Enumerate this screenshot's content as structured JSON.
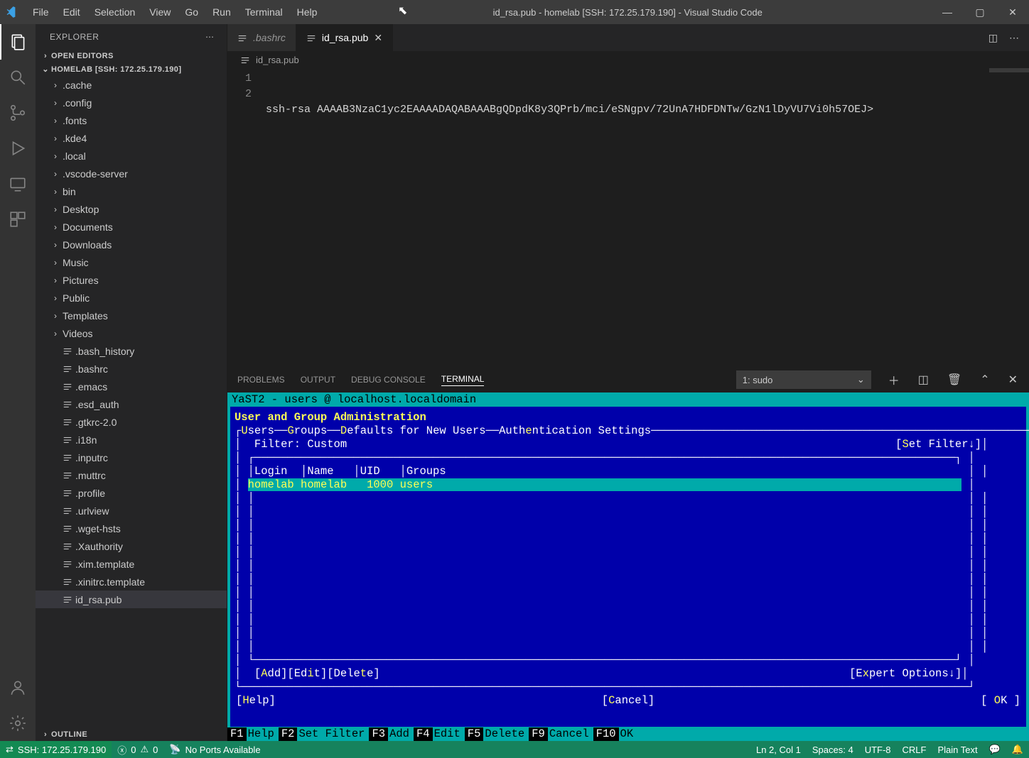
{
  "titlebar": {
    "menus": [
      "File",
      "Edit",
      "Selection",
      "View",
      "Go",
      "Run",
      "Terminal",
      "Help"
    ],
    "title": "id_rsa.pub - homelab [SSH: 172.25.179.190] - Visual Studio Code"
  },
  "sidebar": {
    "title": "EXPLORER",
    "open_editors_label": "OPEN EDITORS",
    "workspace_label": "HOMELAB [SSH: 172.25.179.190]",
    "outline_label": "OUTLINE",
    "folders": [
      ".cache",
      ".config",
      ".fonts",
      ".kde4",
      ".local",
      ".vscode-server",
      "bin",
      "Desktop",
      "Documents",
      "Downloads",
      "Music",
      "Pictures",
      "Public",
      "Templates",
      "Videos"
    ],
    "files": [
      ".bash_history",
      ".bashrc",
      ".emacs",
      ".esd_auth",
      ".gtkrc-2.0",
      ".i18n",
      ".inputrc",
      ".muttrc",
      ".profile",
      ".urlview",
      ".wget-hsts",
      ".Xauthority",
      ".xim.template",
      ".xinitrc.template",
      "id_rsa.pub"
    ],
    "selected_file": "id_rsa.pub"
  },
  "tabs": {
    "items": [
      {
        "name": ".bashrc",
        "active": false,
        "italic": true
      },
      {
        "name": "id_rsa.pub",
        "active": true,
        "italic": false
      }
    ]
  },
  "breadcrumb": {
    "file": "id_rsa.pub"
  },
  "editor": {
    "line1": "ssh-rsa AAAAB3NzaC1yc2EAAAADAQABAAABgQDpdK8y3QPrb/mci/eSNgpv/72UnA7HDFDNTw/GzN1lDyVU7Vi0h57OEJ>",
    "line_numbers": [
      "1",
      "2"
    ]
  },
  "panel": {
    "tabs": [
      "PROBLEMS",
      "OUTPUT",
      "DEBUG CONSOLE",
      "TERMINAL"
    ],
    "active_tab": "TERMINAL",
    "terminal_select": "1: sudo"
  },
  "yast": {
    "topbar": "YaST2 - users @ localhost.localdomain",
    "heading": "User and Group Administration",
    "tabs_raw": "┌Users──Groups──Defaults for New Users──Authentication Settings───────────────────────────────────────────────┐",
    "filter_label": "Filter: Custom",
    "set_filter": "[Set Filter↓]",
    "table_header": "│Login  │Name   │UID   │Groups",
    "row_login": "homelab",
    "row_name": "homelab",
    "row_uid": "1000",
    "row_groups": "users",
    "actions": "[Add][Edit][Delete]",
    "expert": "[Expert Options↓]",
    "help": "[Help]",
    "cancel": "[Cancel]",
    "ok": "[ OK ]",
    "fkeys": [
      {
        "key": "F1",
        "label": "Help"
      },
      {
        "key": "F2",
        "label": "Set Filter"
      },
      {
        "key": "F3",
        "label": "Add"
      },
      {
        "key": "F4",
        "label": "Edit"
      },
      {
        "key": "F5",
        "label": "Delete"
      },
      {
        "key": "F9",
        "label": "Cancel"
      },
      {
        "key": "F10",
        "label": "OK"
      }
    ]
  },
  "statusbar": {
    "remote": "SSH: 172.25.179.190",
    "errors": "0",
    "warnings": "0",
    "ports": "No Ports Available",
    "cursor": "Ln 2, Col 1",
    "spaces": "Spaces: 4",
    "encoding": "UTF-8",
    "eol": "CRLF",
    "lang": "Plain Text"
  }
}
